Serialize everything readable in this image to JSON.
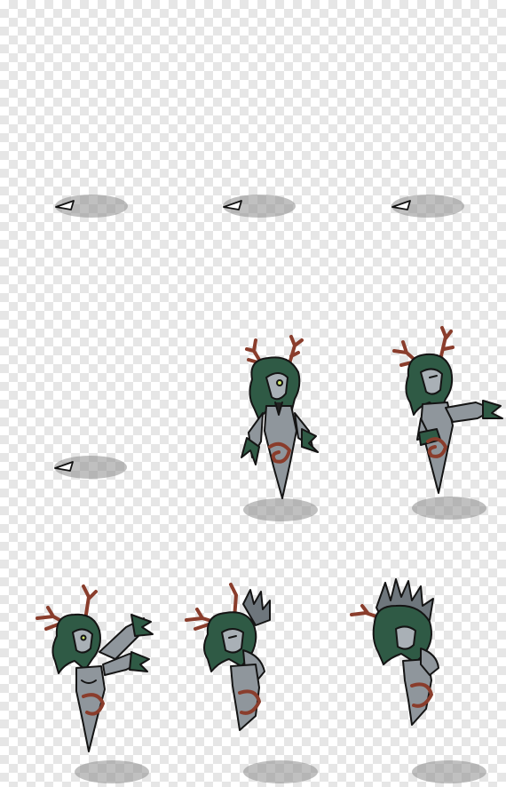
{
  "sprite_sheet": {
    "columns": 3,
    "rows": 3,
    "background": "transparent-checker",
    "palette": {
      "foliage": "#2f5a45",
      "foliage_dark": "#1d3b2c",
      "skin": "#8f969c",
      "skin_light": "#a9b0b6",
      "bark": "#8a3d2c",
      "bark_light": "#b4634a",
      "eye": "#cde36a",
      "outline": "#141414",
      "shadow": "#8c8c8c"
    },
    "frames": [
      {
        "id": "frame-1",
        "state": "empty",
        "has_marker": true
      },
      {
        "id": "frame-2",
        "state": "empty",
        "has_marker": true
      },
      {
        "id": "frame-3",
        "state": "empty",
        "has_marker": true
      },
      {
        "id": "frame-4",
        "state": "empty",
        "has_marker": true
      },
      {
        "id": "frame-5",
        "state": "idle"
      },
      {
        "id": "frame-6",
        "state": "reach"
      },
      {
        "id": "frame-7",
        "state": "cast-arms-raised"
      },
      {
        "id": "frame-8",
        "state": "transform-partial"
      },
      {
        "id": "frame-9",
        "state": "transform-bloom"
      }
    ]
  }
}
